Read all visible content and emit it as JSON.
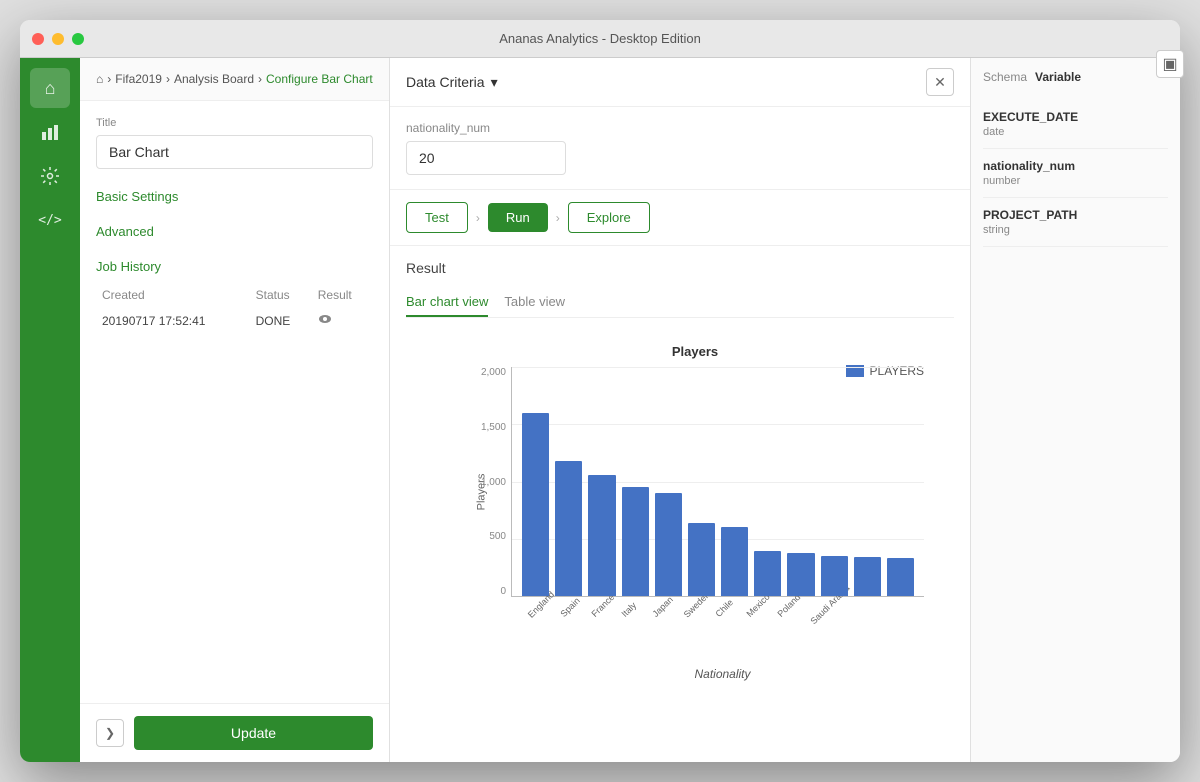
{
  "window": {
    "title": "Ananas Analytics - Desktop Edition"
  },
  "titlebar": {
    "title": "Ananas Analytics - Desktop Edition"
  },
  "breadcrumb": {
    "home": "⌂",
    "items": [
      "Fifa2019",
      "Analysis Board",
      "Configure Bar Chart"
    ],
    "separators": [
      ">",
      ">",
      ">"
    ]
  },
  "left_panel": {
    "title_label": "Title",
    "title_value": "Bar Chart",
    "basic_settings_label": "Basic Settings",
    "advanced_label": "Advanced",
    "job_history_label": "Job History",
    "job_table": {
      "headers": [
        "Created",
        "Status",
        "Result"
      ],
      "rows": [
        {
          "created": "20190717 17:52:41",
          "status": "DONE",
          "result": "eye"
        }
      ]
    },
    "update_button": "Update",
    "collapse_icon": "❯"
  },
  "main": {
    "data_criteria_label": "Data Criteria",
    "param_label": "nationality_num",
    "param_value": "20",
    "test_button": "Test",
    "run_button": "Run",
    "explore_button": "Explore",
    "result_label": "Result",
    "view_tabs": [
      {
        "label": "Bar chart view",
        "active": true
      },
      {
        "label": "Table view",
        "active": false
      }
    ],
    "chart": {
      "title": "Players",
      "legend_label": "PLAYERS",
      "y_axis_label": "Players",
      "x_axis_label": "Nationality",
      "y_ticks": [
        "0",
        "500",
        "1,000",
        "1,500",
        "2,000"
      ],
      "bars": [
        {
          "country": "England",
          "value": 1600,
          "height_pct": 80
        },
        {
          "country": "Spain",
          "value": 1180,
          "height_pct": 59
        },
        {
          "country": "France",
          "value": 1060,
          "height_pct": 53
        },
        {
          "country": "Italy",
          "value": 950,
          "height_pct": 47.5
        },
        {
          "country": "Japan",
          "value": 900,
          "height_pct": 45
        },
        {
          "country": "Sweden",
          "value": 640,
          "height_pct": 32
        },
        {
          "country": "Chile",
          "value": 600,
          "height_pct": 30
        },
        {
          "country": "Mexico",
          "value": 390,
          "height_pct": 19.5
        },
        {
          "country": "Poland",
          "value": 380,
          "height_pct": 19
        },
        {
          "country": "Saudi Arabia",
          "value": 350,
          "height_pct": 17.5
        },
        {
          "country": "",
          "value": 340,
          "height_pct": 17
        },
        {
          "country": "",
          "value": 330,
          "height_pct": 16.5
        }
      ]
    }
  },
  "right_panel": {
    "schema_label": "Schema",
    "variable_label": "Variable",
    "variables": [
      {
        "name": "EXECUTE_DATE",
        "type": "date"
      },
      {
        "name": "nationality_num",
        "type": "number"
      },
      {
        "name": "PROJECT_PATH",
        "type": "string"
      }
    ]
  },
  "sidebar": {
    "icons": [
      {
        "name": "home-icon",
        "symbol": "⌂"
      },
      {
        "name": "chart-icon",
        "symbol": "📊"
      },
      {
        "name": "settings-icon",
        "symbol": "⚙"
      },
      {
        "name": "code-icon",
        "symbol": "</>"
      }
    ]
  }
}
